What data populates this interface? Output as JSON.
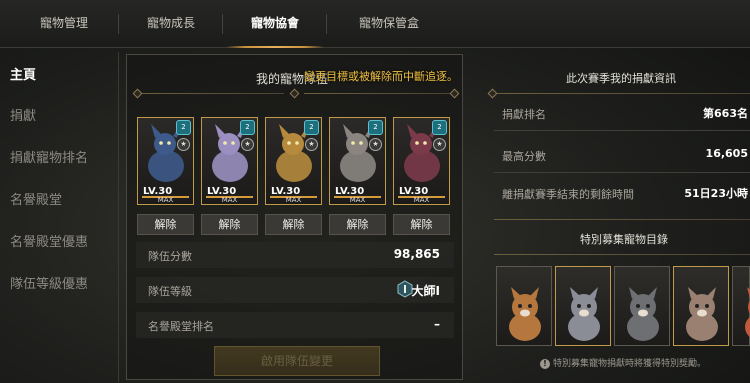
{
  "tabs": [
    {
      "label": "寵物管理"
    },
    {
      "label": "寵物成長"
    },
    {
      "label": "寵物協會"
    },
    {
      "label": "寵物保管盒"
    }
  ],
  "sidebar": {
    "items": [
      {
        "label": "主頁"
      },
      {
        "label": "捐獻"
      },
      {
        "label": "捐獻寵物排名"
      },
      {
        "label": "名譽殿堂"
      },
      {
        "label": "名譽殿堂優惠"
      },
      {
        "label": "隊伍等級優惠"
      }
    ]
  },
  "team": {
    "title": "我的寵物隊伍",
    "warning": "變更目標或被解除而中斷追逐。",
    "pets": [
      {
        "level": "LV.30",
        "max": "MAX",
        "release": "解除",
        "grade": "2",
        "color": "#3d5a8a"
      },
      {
        "level": "LV.30",
        "max": "MAX",
        "release": "解除",
        "grade": "2",
        "color": "#9a8fc0"
      },
      {
        "level": "LV.30",
        "max": "MAX",
        "release": "解除",
        "grade": "2",
        "color": "#b58a3d"
      },
      {
        "level": "LV.30",
        "max": "MAX",
        "release": "解除",
        "grade": "2",
        "color": "#8a8580"
      },
      {
        "level": "LV.30",
        "max": "MAX",
        "release": "解除",
        "grade": "2",
        "color": "#7a3a4a"
      }
    ],
    "stats": {
      "score_label": "隊伍分數",
      "score_value": "98,865",
      "level_label": "隊伍等級",
      "level_value": "大師I",
      "hall_label": "名譽殿堂排名",
      "hall_value": "–"
    },
    "apply_button": "啟用隊伍變更"
  },
  "season": {
    "title": "此次賽季我的捐獻資訊",
    "rank_label": "捐獻排名",
    "rank_value": "第663名",
    "best_label": "最高分數",
    "best_value": "16,605",
    "remain_label": "離捐獻賽季結束的剩餘時間",
    "remain_value": "51日23小時"
  },
  "special": {
    "title": "特別募集寵物目錄",
    "note": "特別募集寵物捐獻時將獲得特別獎勵。",
    "pets": [
      {
        "color": "#b5773d"
      },
      {
        "color": "#8a8d96"
      },
      {
        "color": "#6e6f72"
      },
      {
        "color": "#9a8070"
      },
      {
        "color": "#c05a3a"
      }
    ]
  }
}
